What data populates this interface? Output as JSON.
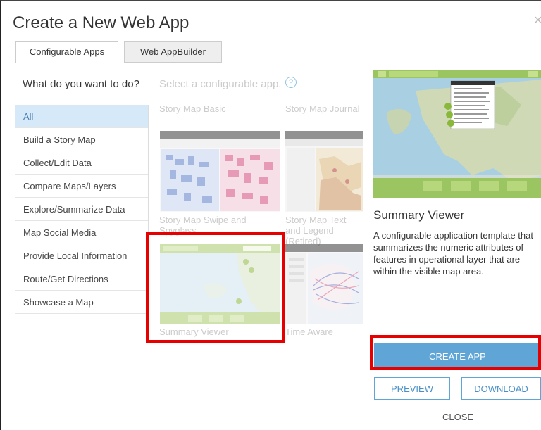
{
  "dialog": {
    "title": "Create a New Web App",
    "close_glyph": "×"
  },
  "tabs": [
    {
      "label": "Configurable Apps",
      "active": true
    },
    {
      "label": "Web AppBuilder",
      "active": false
    }
  ],
  "sidebar": {
    "question": "What do you want to do?",
    "items": [
      {
        "label": "All",
        "selected": true
      },
      {
        "label": "Build a Story Map"
      },
      {
        "label": "Collect/Edit Data"
      },
      {
        "label": "Compare Maps/Layers"
      },
      {
        "label": "Explore/Summarize Data"
      },
      {
        "label": "Map Social Media"
      },
      {
        "label": "Provide Local Information"
      },
      {
        "label": "Route/Get Directions"
      },
      {
        "label": "Showcase a Map"
      }
    ]
  },
  "gallery": {
    "hint": "Select a configurable app.",
    "help_glyph": "?",
    "cards": [
      {
        "label": "Story Map Basic"
      },
      {
        "label": "Story Map Journal"
      },
      {
        "label": "Story Map Swipe and Spyglass"
      },
      {
        "label": "Story Map Text and Legend (Retired)"
      },
      {
        "label": "Summary Viewer"
      },
      {
        "label": "Time Aware"
      }
    ]
  },
  "detail": {
    "title": "Summary Viewer",
    "description": "A configurable application template that summarizes the numeric attributes of features in operational layer that are within the visible map area.",
    "create_label": "CREATE APP",
    "preview_label": "PREVIEW",
    "download_label": "DOWNLOAD",
    "close_label": "CLOSE"
  },
  "colors": {
    "accent": "#5fa5d6",
    "highlight": "#e60000",
    "selected_bg": "#d6e9f8"
  }
}
